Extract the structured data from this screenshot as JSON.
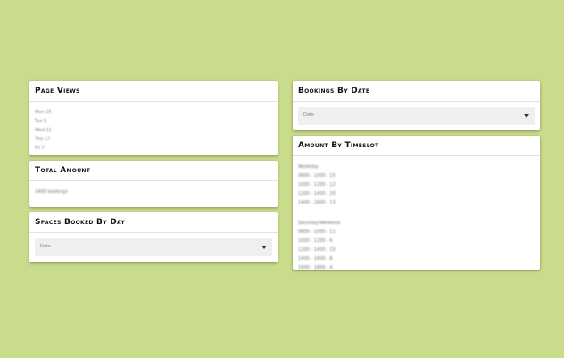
{
  "cards": {
    "page_views": {
      "title": "Page Views",
      "lines": [
        "Mon 15",
        "Tue 5",
        "Wed 11",
        "Thu 17",
        "Fri 7"
      ]
    },
    "total_amount": {
      "title": "Total Amount",
      "lines": [
        "1400 bookings"
      ]
    },
    "spaces_booked": {
      "title": "Spaces Booked By Day",
      "select_value": "Date"
    },
    "bookings_by_date": {
      "title": "Bookings By Date",
      "select_value": "Date"
    },
    "amount_by_timeslot": {
      "title": "Amount By Timeslot",
      "lines_a": [
        "Weekday",
        "0800 - 1000 - 15",
        "1000 - 1200 - 12",
        "1200 - 1400 - 20",
        "1400 - 1600 - 13"
      ],
      "lines_b": [
        "Saturday/Weekend",
        "0800 - 1000 - 11",
        "1000 - 1200 - 6",
        "1200 - 1400 - 15",
        "1400 - 1600 - 8",
        "1600 - 1800 - 4"
      ]
    }
  }
}
